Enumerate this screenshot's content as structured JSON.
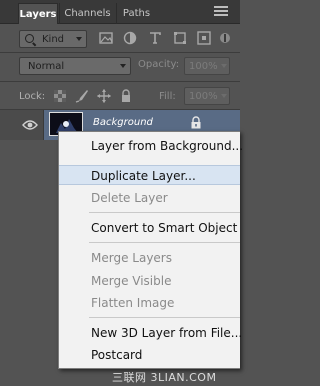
{
  "tabs": [
    {
      "label": "Layers"
    },
    {
      "label": "Channels"
    },
    {
      "label": "Paths"
    }
  ],
  "filter": {
    "kind_label": "Kind"
  },
  "blend": {
    "mode": "Normal",
    "opacity_label": "Opacity:",
    "opacity_value": "100%"
  },
  "lock": {
    "label": "Lock:",
    "fill_label": "Fill:",
    "fill_value": "100%"
  },
  "layer": {
    "name": "Background"
  },
  "context_menu": {
    "items": [
      {
        "label": "Layer from Background...",
        "enabled": true
      },
      {
        "label": "Duplicate Layer...",
        "enabled": true
      },
      {
        "label": "Delete Layer",
        "enabled": false
      },
      {
        "label": "Convert to Smart Object",
        "enabled": true
      },
      {
        "label": "Merge Layers",
        "enabled": false
      },
      {
        "label": "Merge Visible",
        "enabled": false
      },
      {
        "label": "Flatten Image",
        "enabled": false
      },
      {
        "label": "New 3D Layer from File...",
        "enabled": true
      },
      {
        "label": "Postcard",
        "enabled": true
      }
    ]
  },
  "watermark": "三联网 3LIAN.COM",
  "colors": {
    "panel_bg": "#535353",
    "tab_bar_bg": "#393939",
    "selected_layer_bg": "#596b85",
    "menu_bg": "#f2f2f2",
    "menu_highlight": "#d8e4f2"
  }
}
